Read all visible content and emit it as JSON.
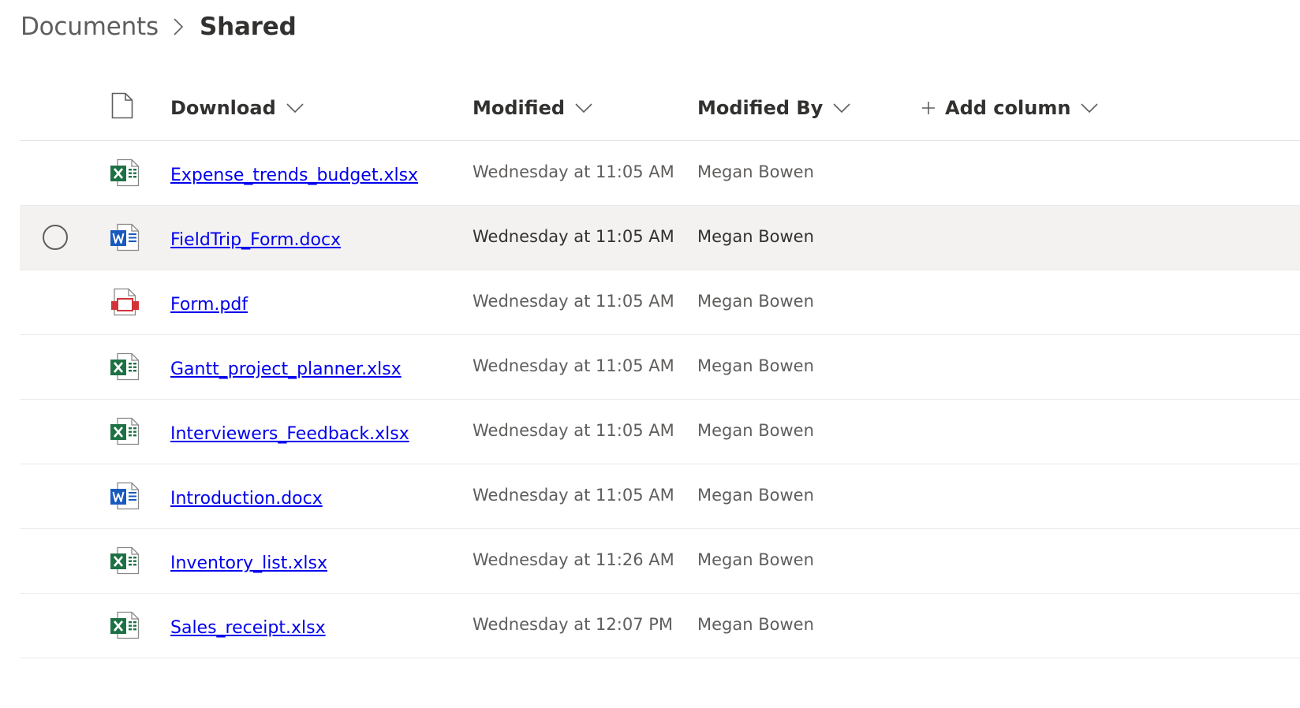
{
  "breadcrumb": {
    "root": "Documents",
    "current": "Shared"
  },
  "columns": {
    "name": "Download",
    "modified": "Modified",
    "modified_by": "Modified By",
    "add": "Add column"
  },
  "files": [
    {
      "name": "Expense_trends_budget.xlsx",
      "type": "excel",
      "modified": "Wednesday at 11:05 AM",
      "modified_by": "Megan Bowen"
    },
    {
      "name": "FieldTrip_Form.docx",
      "type": "word",
      "modified": "Wednesday at 11:05 AM",
      "modified_by": "Megan Bowen"
    },
    {
      "name": "Form.pdf",
      "type": "pdf",
      "modified": "Wednesday at 11:05 AM",
      "modified_by": "Megan Bowen"
    },
    {
      "name": "Gantt_project_planner.xlsx",
      "type": "excel",
      "modified": "Wednesday at 11:05 AM",
      "modified_by": "Megan Bowen"
    },
    {
      "name": "Interviewers_Feedback.xlsx",
      "type": "excel",
      "modified": "Wednesday at 11:05 AM",
      "modified_by": "Megan Bowen"
    },
    {
      "name": "Introduction.docx",
      "type": "word",
      "modified": "Wednesday at 11:05 AM",
      "modified_by": "Megan Bowen"
    },
    {
      "name": "Inventory_list.xlsx",
      "type": "excel",
      "modified": "Wednesday at 11:26 AM",
      "modified_by": "Megan Bowen"
    },
    {
      "name": "Sales_receipt.xlsx",
      "type": "excel",
      "modified": "Wednesday at 12:07 PM",
      "modified_by": "Megan Bowen"
    }
  ],
  "colors": {
    "excel": "#1e7145",
    "word": "#185abd",
    "pdf": "#d13438",
    "link": "#0000ee"
  }
}
